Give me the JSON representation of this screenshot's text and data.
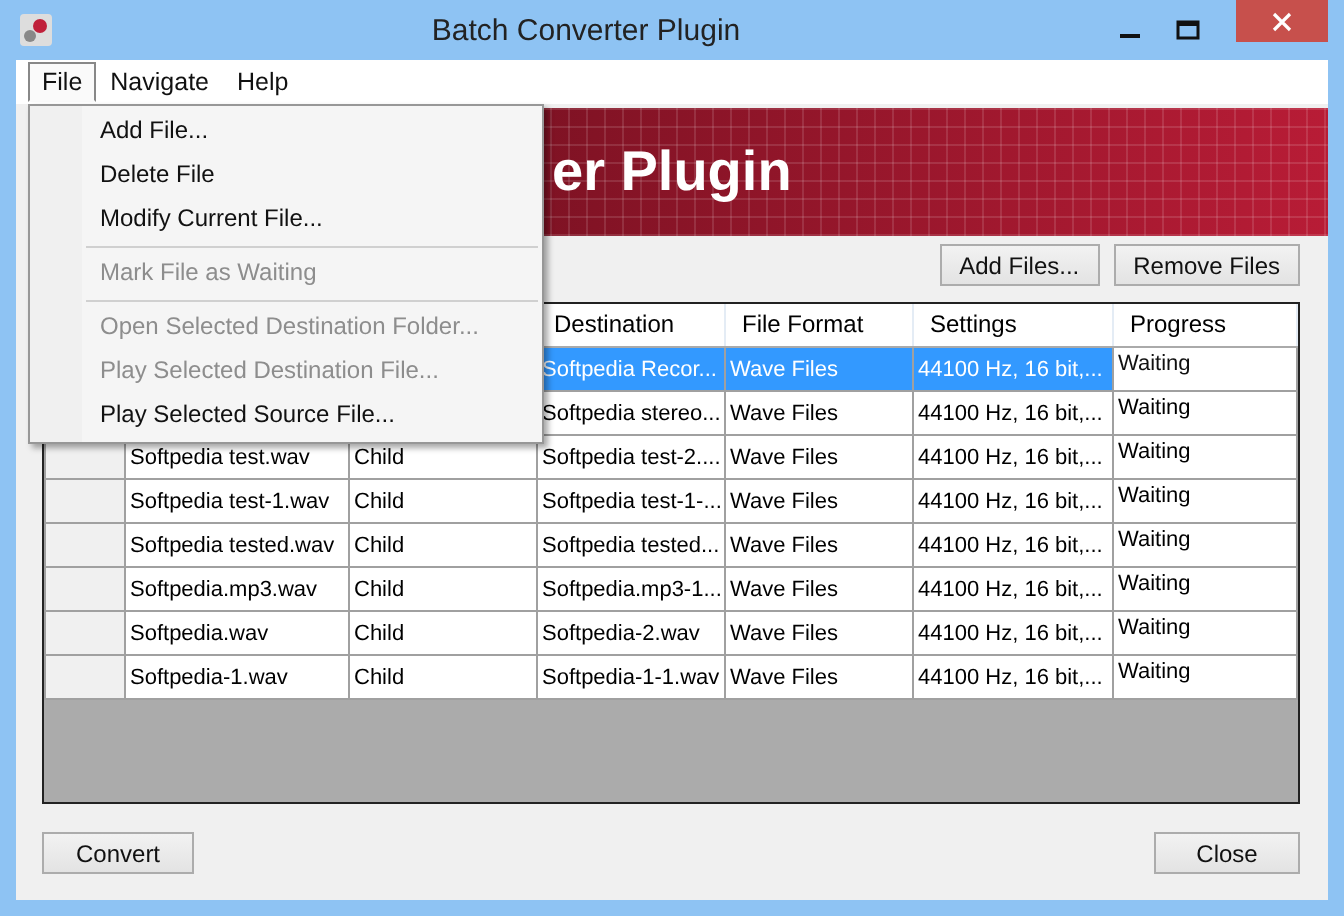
{
  "window": {
    "title": "Batch Converter Plugin"
  },
  "menu_bar": [
    {
      "label": "File",
      "selected": true
    },
    {
      "label": "Navigate",
      "selected": false
    },
    {
      "label": "Help",
      "selected": false
    }
  ],
  "banner": {
    "title": "er Plugin"
  },
  "toolbar_buttons": [
    "Add Files...",
    "Remove Files"
  ],
  "table": {
    "columns": [
      "Destination",
      "File Format",
      "Settings",
      "Progress"
    ],
    "rows": [
      {
        "selected": true,
        "destination": "Softpedia Recor...",
        "format": "Wave Files",
        "settings": "44100 Hz, 16 bit,...",
        "progress": "Waiting"
      },
      {
        "selected": false,
        "destination": "Softpedia stereo...",
        "format": "Wave Files",
        "settings": "44100 Hz, 16 bit,...",
        "progress": "Waiting"
      },
      {
        "selected": false,
        "source": "Softpedia test.wav",
        "type": "Child",
        "destination": "Softpedia test-2....",
        "format": "Wave Files",
        "settings": "44100 Hz, 16 bit,...",
        "progress": "Waiting"
      },
      {
        "selected": false,
        "source": "Softpedia test-1.wav",
        "type": "Child",
        "destination": "Softpedia test-1-...",
        "format": "Wave Files",
        "settings": "44100 Hz, 16 bit,...",
        "progress": "Waiting"
      },
      {
        "selected": false,
        "source": "Softpedia tested.wav",
        "type": "Child",
        "destination": "Softpedia tested...",
        "format": "Wave Files",
        "settings": "44100 Hz, 16 bit,...",
        "progress": "Waiting"
      },
      {
        "selected": false,
        "source": "Softpedia.mp3.wav",
        "type": "Child",
        "destination": "Softpedia.mp3-1...",
        "format": "Wave Files",
        "settings": "44100 Hz, 16 bit,...",
        "progress": "Waiting"
      },
      {
        "selected": false,
        "source": "Softpedia.wav",
        "type": "Child",
        "destination": "Softpedia-2.wav",
        "format": "Wave Files",
        "settings": "44100 Hz, 16 bit,...",
        "progress": "Waiting"
      },
      {
        "selected": false,
        "source": "Softpedia-1.wav",
        "type": "Child",
        "destination": "Softpedia-1-1.wav",
        "format": "Wave Files",
        "settings": "44100 Hz, 16 bit,...",
        "progress": "Waiting"
      }
    ]
  },
  "file_menu": [
    {
      "kind": "item",
      "label": "Add File...",
      "disabled": false
    },
    {
      "kind": "item",
      "label": "Delete File",
      "disabled": false
    },
    {
      "kind": "item",
      "label": "Modify Current File...",
      "disabled": false
    },
    {
      "kind": "separator"
    },
    {
      "kind": "item",
      "label": "Mark File as Waiting",
      "disabled": true
    },
    {
      "kind": "separator"
    },
    {
      "kind": "item",
      "label": "Open Selected Destination Folder...",
      "disabled": true
    },
    {
      "kind": "item",
      "label": "Play Selected Destination File...",
      "disabled": true
    },
    {
      "kind": "item",
      "label": "Play Selected Source File...",
      "disabled": false
    }
  ],
  "footer_buttons": [
    "Convert",
    "Close"
  ]
}
